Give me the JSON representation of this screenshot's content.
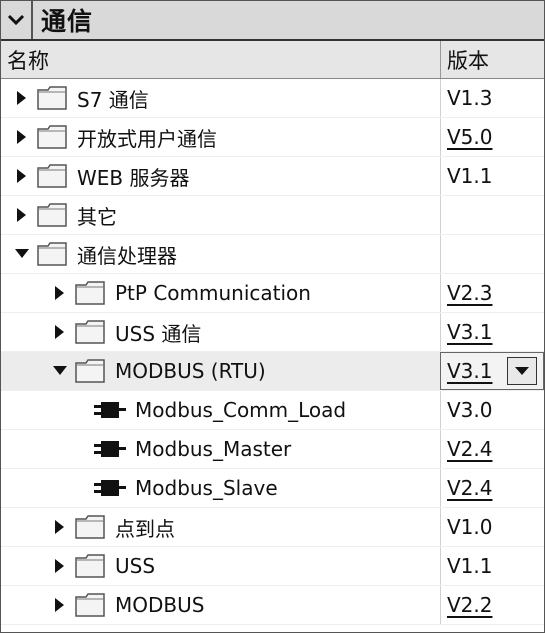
{
  "panel": {
    "title": "通信"
  },
  "columns": {
    "name": "名称",
    "version": "版本"
  },
  "rows": [
    {
      "label": "S7 通信",
      "version": "V1.3",
      "underlined": false,
      "expand": "collapsed",
      "icon": "folder",
      "indent": 0
    },
    {
      "label": "开放式用户通信",
      "version": "V5.0",
      "underlined": true,
      "expand": "collapsed",
      "icon": "folder",
      "indent": 0
    },
    {
      "label": "WEB 服务器",
      "version": "V1.1",
      "underlined": false,
      "expand": "collapsed",
      "icon": "folder",
      "indent": 0
    },
    {
      "label": "其它",
      "version": "",
      "underlined": false,
      "expand": "collapsed",
      "icon": "folder",
      "indent": 0
    },
    {
      "label": "通信处理器",
      "version": "",
      "underlined": false,
      "expand": "expanded",
      "icon": "folder",
      "indent": 0
    },
    {
      "label": "PtP Communication",
      "version": "V2.3",
      "underlined": true,
      "expand": "collapsed",
      "icon": "folder",
      "indent": 1
    },
    {
      "label": "USS 通信",
      "version": "V3.1",
      "underlined": true,
      "expand": "collapsed",
      "icon": "folder",
      "indent": 1
    },
    {
      "label": "MODBUS (RTU)",
      "version": "V3.1",
      "underlined": true,
      "expand": "expanded",
      "icon": "folder",
      "indent": 1,
      "selected": true,
      "dropdown": true
    },
    {
      "label": "Modbus_Comm_Load",
      "version": "V3.0",
      "underlined": false,
      "expand": "none",
      "icon": "block",
      "indent": 2
    },
    {
      "label": "Modbus_Master",
      "version": "V2.4",
      "underlined": true,
      "expand": "none",
      "icon": "block",
      "indent": 2
    },
    {
      "label": "Modbus_Slave",
      "version": "V2.4",
      "underlined": true,
      "expand": "none",
      "icon": "block",
      "indent": 2
    },
    {
      "label": "点到点",
      "version": "V1.0",
      "underlined": false,
      "expand": "collapsed",
      "icon": "folder",
      "indent": 1
    },
    {
      "label": "USS",
      "version": "V1.1",
      "underlined": false,
      "expand": "collapsed",
      "icon": "folder",
      "indent": 1
    },
    {
      "label": "MODBUS",
      "version": "V2.2",
      "underlined": true,
      "expand": "collapsed",
      "icon": "folder",
      "indent": 1
    }
  ]
}
